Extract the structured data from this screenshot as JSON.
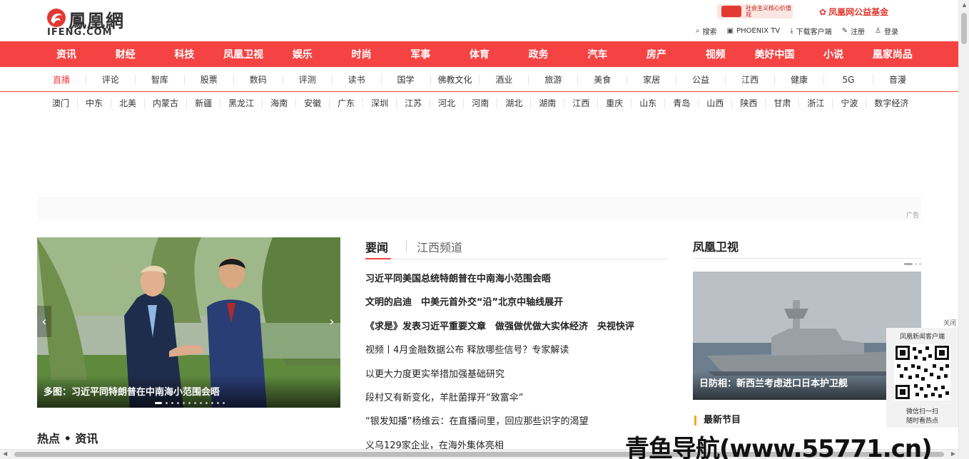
{
  "brand": {
    "name": "鳳凰網",
    "domain": "IFENG.COM"
  },
  "promo": {
    "left_text": "社会主义核心价值观",
    "right_text": "凤凰网公益基金"
  },
  "toplinks": [
    {
      "icon": "search-icon",
      "label": "搜索"
    },
    {
      "icon": "tv-icon",
      "label": "PHOENIX TV"
    },
    {
      "icon": "download-icon",
      "label": "下载客户端"
    },
    {
      "icon": "edit-icon",
      "label": "注册"
    },
    {
      "icon": "user-icon",
      "label": "登录"
    }
  ],
  "mainnav": [
    "资讯",
    "财经",
    "科技",
    "凤凰卫视",
    "娱乐",
    "时尚",
    "军事",
    "体育",
    "政务",
    "汽车",
    "房产",
    "视频",
    "美好中国",
    "小说",
    "凰家尚品"
  ],
  "subnav": [
    "直播",
    "评论",
    "智库",
    "股票",
    "数码",
    "评测",
    "读书",
    "国学",
    "佛教文化",
    "酒业",
    "旅游",
    "美食",
    "家居",
    "公益",
    "江西",
    "健康",
    "5G",
    "音漫"
  ],
  "regionnav": [
    "澳门",
    "中东",
    "北美",
    "内蒙古",
    "新疆",
    "黑龙江",
    "海南",
    "安徽",
    "广东",
    "深圳",
    "江苏",
    "河北",
    "河南",
    "湖北",
    "湖南",
    "江西",
    "重庆",
    "山东",
    "青岛",
    "山西",
    "陕西",
    "甘肃",
    "浙江",
    "宁波",
    "数字经济"
  ],
  "ad": {
    "label": "广告"
  },
  "slider": {
    "caption": "多图：习近平同特朗普在中南海小范围会晤"
  },
  "hot": {
    "title": "热点 • 资讯"
  },
  "news": {
    "tabs": [
      "要闻",
      "江西频道"
    ],
    "items": [
      {
        "text": "习近平同美国总统特朗普在中南海小范围会晤",
        "bold": true
      },
      {
        "text": "文明的启迪　中美元首外交“沿”北京中轴线展开",
        "bold": true
      },
      {
        "text": "《求是》发表习近平重要文章　做强做优做大实体经济　央视快评",
        "bold": true
      },
      {
        "text": "视频丨4月金融数据公布 释放哪些信号？专家解读",
        "bold": false
      },
      {
        "text": "以更大力度更实举措加强基础研究",
        "bold": false
      },
      {
        "text": "段村又有新变化，羊肚菌撑开“致富伞”",
        "bold": false
      },
      {
        "text": "“银发知播”杨维云：在直播间里，回应那些识字的渴望",
        "bold": false
      },
      {
        "text": "义乌129家企业，在海外集体亮相",
        "bold": false
      }
    ]
  },
  "fhtv": {
    "title": "凤凰卫视",
    "caption": "日防相：新西兰考虑进口日本护卫舰",
    "latest": "最新节目"
  },
  "qr": {
    "title": "凤凰新闻客户端",
    "line1": "微信扫一扫",
    "line2": "随时看热点",
    "close": "关闭"
  },
  "watermark": "青鱼导航(www.55771.cn)"
}
